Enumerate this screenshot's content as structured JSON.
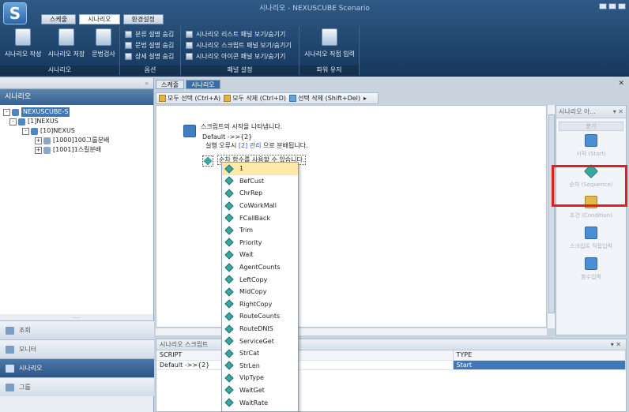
{
  "window": {
    "title": "시나리오 - NEXUSCUBE Scenario",
    "logo": "S"
  },
  "ribbon": {
    "tabs": [
      "스케줄",
      "시나리오",
      "환경설정"
    ],
    "active_tab": 1,
    "groups": {
      "scenario": {
        "label": "시나리오",
        "buttons": [
          "시나리오 작성",
          "시나리오 저장",
          "문법검사"
        ]
      },
      "options": {
        "label": "옵션",
        "items": [
          "분류 설명 숨김",
          "문법 설명 숨김",
          "상세 설명 숨김"
        ]
      },
      "panel": {
        "label": "패널 설정",
        "items": [
          "시나리오 리스트 패널 보기/숨기기",
          "시나리오 스크립트 패널 보기/숨기기",
          "시나리오 아이콘 패널 보기/숨기기"
        ]
      },
      "params": {
        "label": "파워 유저",
        "buttons": [
          "시나리오 직접 입력"
        ]
      }
    }
  },
  "left_pane": {
    "collapse_glyph": "«",
    "title": "시나리오",
    "tree": [
      {
        "label": "NEXUSCUBE-S",
        "level": 0,
        "toggle": "-",
        "selected": true
      },
      {
        "label": "[1]NEXUS",
        "level": 1,
        "toggle": "-"
      },
      {
        "label": "[10]NEXUS",
        "level": 2,
        "toggle": "-"
      },
      {
        "label": "[1000]100그룹분배",
        "level": 3,
        "toggle": "+"
      },
      {
        "label": "[1001]1스킬분배",
        "level": 3,
        "toggle": "+"
      }
    ],
    "grip": "....",
    "nav": [
      "조회",
      "모니터",
      "시나리오",
      "그룹"
    ],
    "nav_active": 2
  },
  "doc_tabs": [
    "스케줄",
    "시나리오"
  ],
  "doc_tab_active": 1,
  "toolbar": {
    "items": [
      "모두 선택 (Ctrl+A)",
      "모두 삭제 (Ctrl+D)",
      "선택 삭제 (Shift+Del)"
    ],
    "more": "▸"
  },
  "canvas": {
    "start_text": "스크립트의 시작을 나타냅니다.",
    "default_line": "Default ->>{2}",
    "error_prefix": "실행 오류시 ",
    "error_link": "[2] 관리",
    "error_suffix": " 으로 분배됩니다.",
    "func_text": "순차 함수를 사용할 수 있습니다."
  },
  "autocomplete": [
    "1",
    "BefCust",
    "ChrRep",
    "CoWorkMall",
    "FCallBack",
    "Trim",
    "Priority",
    "Wait",
    "AgentCounts",
    "LeftCopy",
    "MidCopy",
    "RightCopy",
    "RouteCounts",
    "RouteDNIS",
    "ServiceGet",
    "StrCat",
    "StrLen",
    "VipType",
    "WaitGet",
    "WaitRate"
  ],
  "autocomplete_selected": 0,
  "right_pane": {
    "title": "시나리오 아...",
    "pin": "▾ ✕",
    "sub": "분기",
    "tools": [
      "시작 (Start)",
      "순차 (Sequence)",
      "조건 (Condition)",
      "스크립트 직접입력",
      "함수입력"
    ]
  },
  "bottom_pane": {
    "title": "시나리오 스크립트",
    "pin": "▾ ✕",
    "columns": [
      "SCRIPT",
      "TYPE"
    ],
    "rows": [
      [
        "Default ->>{2}",
        "Start"
      ]
    ]
  },
  "colors": {
    "accent": "#3f78b4",
    "highlight": "#e0211b",
    "ribbon": "#17385d"
  }
}
